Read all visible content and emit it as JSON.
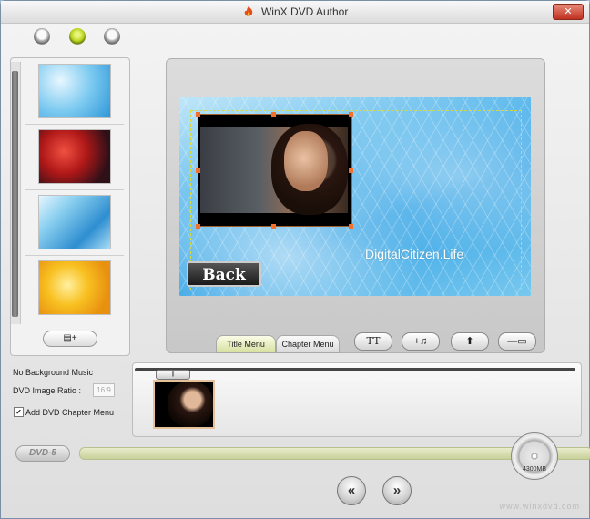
{
  "window": {
    "title": "WinX DVD Author",
    "close_label": "✕"
  },
  "top_circles": [
    "circle-1",
    "circle-2",
    "circle-3"
  ],
  "sidebar": {
    "backgrounds": [
      {
        "name": "light-blue-bokeh"
      },
      {
        "name": "red-flowers"
      },
      {
        "name": "blue-streaks"
      },
      {
        "name": "yellow-flowers"
      }
    ],
    "add_button_label": "▤+"
  },
  "preview": {
    "watermark": "DigitalCitizen.Life",
    "back_button_label": "Back"
  },
  "toolbar": {
    "tabs": [
      {
        "label": "Title Menu",
        "active": true
      },
      {
        "label": "Chapter Menu",
        "active": false
      }
    ],
    "tools": [
      {
        "name": "text-tool",
        "label": "TT"
      },
      {
        "name": "add-music",
        "label": "+♫"
      },
      {
        "name": "upload",
        "label": "⬆"
      },
      {
        "name": "chapter-bar",
        "label": "—▭"
      }
    ]
  },
  "settings": {
    "background_music": "No Background Music",
    "ratio_label": "DVD Image Ratio :",
    "ratio_value": "16:9",
    "chapter_menu_label": "Add DVD Chapter Menu",
    "chapter_menu_checked": true,
    "check_mark": "✔"
  },
  "timeline": {
    "knob_label": "||"
  },
  "capacity": {
    "dvd_type": "DVD-5",
    "disc_size": "4300MB",
    "used_fraction": 0.02
  },
  "nav": {
    "prev_label": "«",
    "next_label": "»"
  },
  "footer_url": "www.winxdvd.com"
}
